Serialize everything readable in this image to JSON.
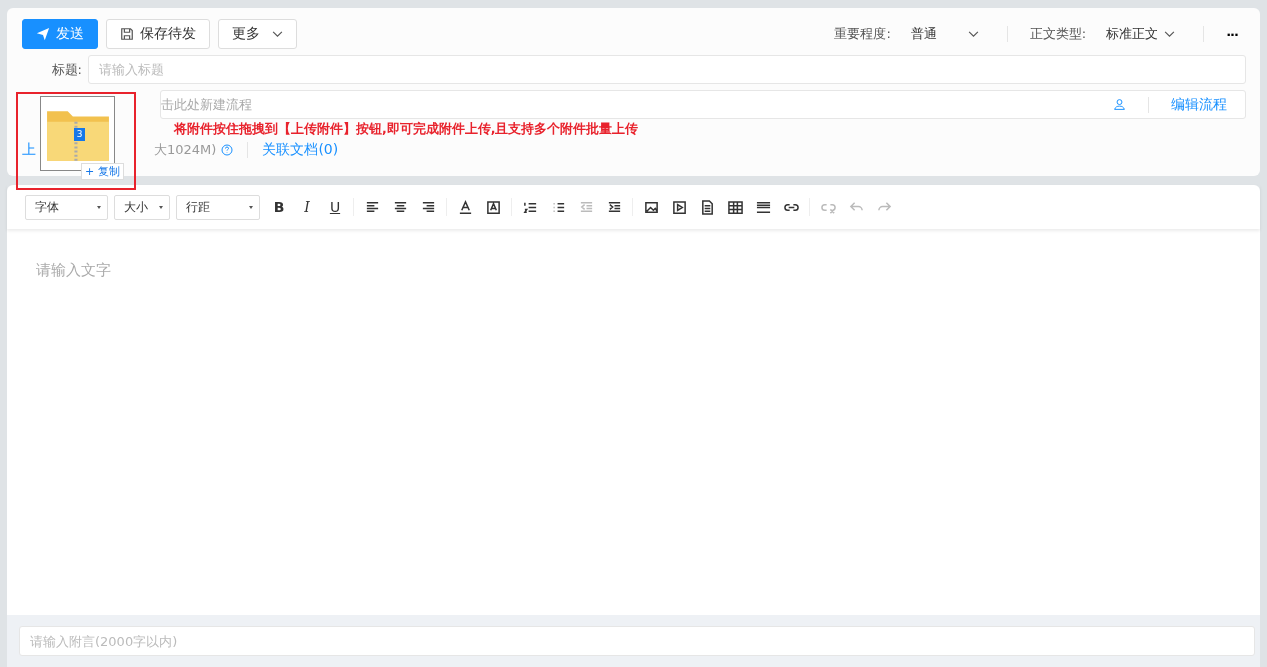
{
  "actions": {
    "send": "发送",
    "save": "保存待发",
    "more": "更多"
  },
  "importance": {
    "label": "重要程度:",
    "value": "普通"
  },
  "body_type": {
    "label": "正文类型:",
    "value": "标准正文"
  },
  "more_menu": "···",
  "title_field": {
    "label": "标题:",
    "placeholder": "请输入标题"
  },
  "flow_field": {
    "placeholder": "击此处新建流程",
    "edit": "编辑流程"
  },
  "attachments": {
    "upload": "上",
    "limit": "大1024M)",
    "related": "关联文档(0)"
  },
  "toolbar": {
    "dropdowns": [
      "字体",
      "大小",
      "行距"
    ],
    "format": [
      "B",
      "I",
      "U"
    ],
    "icons": [
      {
        "kind": "align-left",
        "disabled": false
      },
      {
        "kind": "align-center",
        "disabled": false
      },
      {
        "kind": "align-right",
        "disabled": false
      },
      {
        "kind": "font-color",
        "disabled": false
      },
      {
        "kind": "highlight",
        "disabled": false
      },
      {
        "kind": "ordered-list",
        "disabled": false
      },
      {
        "kind": "bullet-list",
        "disabled": false
      },
      {
        "kind": "outdent",
        "disabled": true
      },
      {
        "kind": "indent",
        "disabled": false
      },
      {
        "kind": "image",
        "disabled": false
      },
      {
        "kind": "video",
        "disabled": false
      },
      {
        "kind": "document",
        "disabled": false
      },
      {
        "kind": "table",
        "disabled": false
      },
      {
        "kind": "rule",
        "disabled": false
      },
      {
        "kind": "link",
        "disabled": false
      },
      {
        "kind": "unlink",
        "disabled": true
      },
      {
        "kind": "undo",
        "disabled": true
      },
      {
        "kind": "redo",
        "disabled": true
      }
    ]
  },
  "editor": {
    "placeholder": "请输入文字"
  },
  "note_field": {
    "placeholder": "请输入附言(2000字以内)"
  },
  "drag_overlay": {
    "badge": "3",
    "copy_label": "+ 复制",
    "hint": "将附件按住拖拽到【上传附件】按钮,即可完成附件上传,且支持多个附件批量上传"
  }
}
